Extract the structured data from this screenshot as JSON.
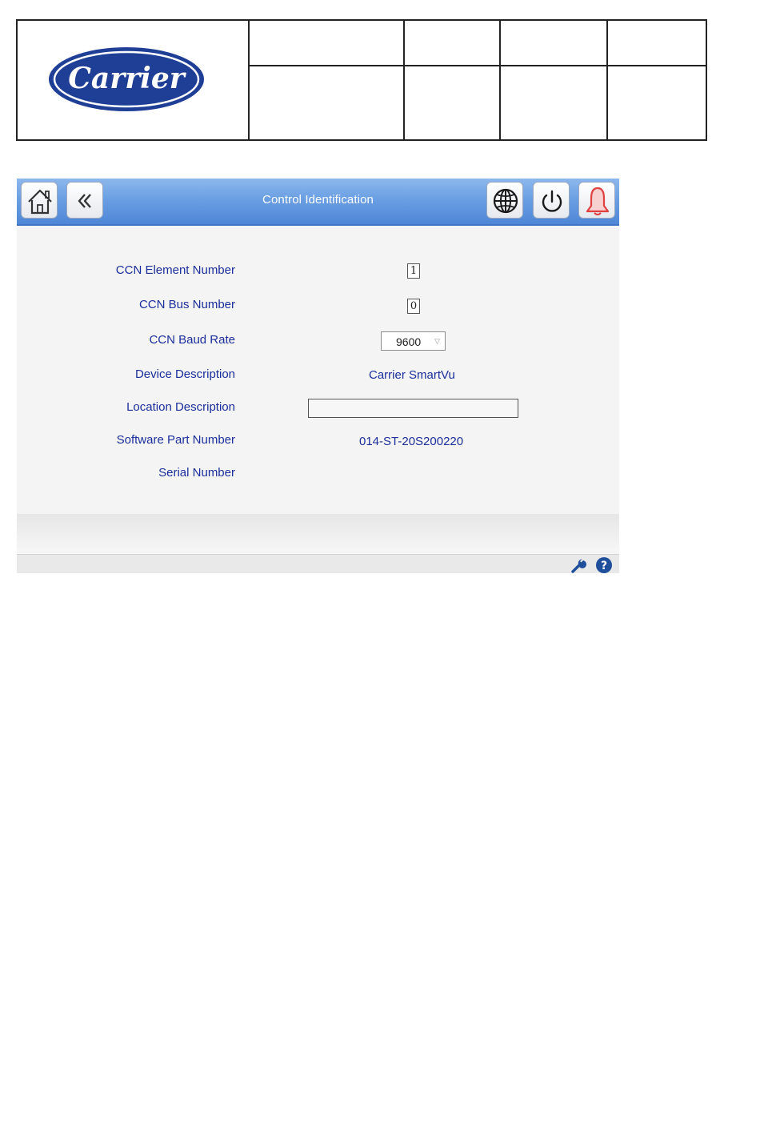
{
  "document_header": {
    "logo_text": "Carrier",
    "brand_color": "#1f3f96"
  },
  "screen": {
    "title": "Control Identification",
    "toolbar": {
      "left_buttons": [
        {
          "icon": "home-icon"
        },
        {
          "icon": "back-chevron-icon"
        }
      ],
      "right_buttons": [
        {
          "icon": "globe-icon"
        },
        {
          "icon": "power-icon"
        },
        {
          "icon": "alarm-bell-icon"
        }
      ]
    },
    "fields": {
      "ccn_element_number": {
        "label": "CCN Element Number",
        "value": "1"
      },
      "ccn_bus_number": {
        "label": "CCN Bus Number",
        "value": "0"
      },
      "ccn_baud_rate": {
        "label": "CCN Baud Rate",
        "value": "9600"
      },
      "device_description": {
        "label": "Device Description",
        "value": "Carrier SmartVu"
      },
      "location_description": {
        "label": "Location Description",
        "value": ""
      },
      "software_part_number": {
        "label": "Software Part Number",
        "value": "014-ST-20S200220"
      },
      "serial_number": {
        "label": "Serial Number",
        "value": ""
      }
    },
    "status_icons": [
      "wrench-icon",
      "help-icon"
    ],
    "colors": {
      "label_text": "#1b2e9c",
      "titlebar_blue": "#5a8fdc",
      "alarm_red": "#e04040"
    }
  }
}
